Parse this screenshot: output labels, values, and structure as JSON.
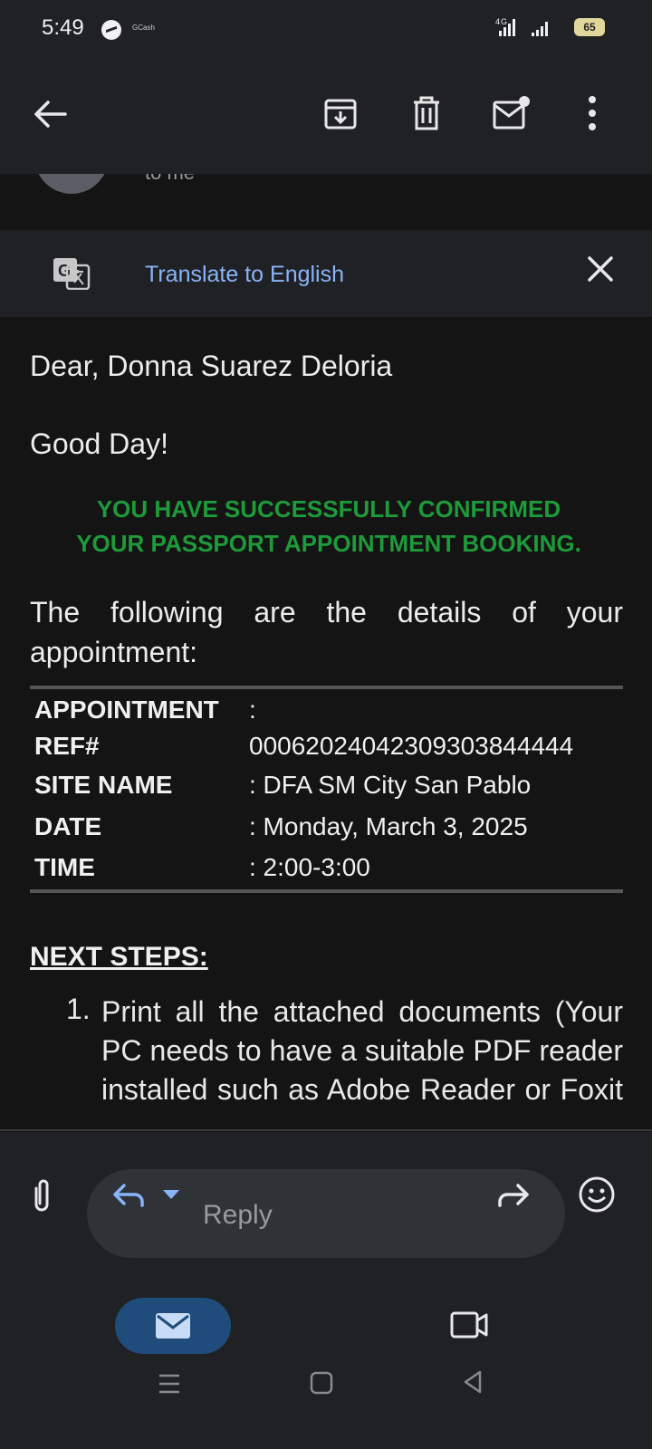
{
  "status_bar": {
    "time": "5:49",
    "app_label": "GCash",
    "network": "4G",
    "battery": "65"
  },
  "toolbar": {
    "icons": [
      "back-arrow-icon",
      "archive-icon",
      "delete-icon",
      "mark-unread-icon",
      "more-vert-icon"
    ]
  },
  "sender": {
    "to_line": "to me"
  },
  "translate": {
    "link": "Translate to English"
  },
  "email": {
    "greeting": "Dear, Donna Suarez Deloria",
    "good_day": "Good Day!",
    "confirm_line1": "YOU HAVE SUCCESSFULLY CONFIRMED",
    "confirm_line2": "YOUR PASSPORT APPOINTMENT BOOKING.",
    "intro": "The following are the details of your appointment:",
    "details": {
      "appointment_label": "APPOINTMENT",
      "ref_label": "REF#",
      "ref_value": "00062024042309303844444",
      "site_label": "SITE NAME",
      "site_value": ": DFA SM City San Pablo",
      "date_label": "DATE",
      "date_value": ": Monday, March 3, 2025",
      "time_label": "TIME",
      "time_value": ": 2:00-3:00"
    },
    "next_steps_heading": "NEXT STEPS:",
    "step_number": "1.",
    "step_text": "Print all the attached documents (Your PC needs to have a suitable PDF reader installed such as Adobe Reader or Foxit"
  },
  "reply_bar": {
    "reply_label": "Reply"
  },
  "colors": {
    "background": "#141414",
    "surface": "#1f2125",
    "link": "#8ab4f8",
    "success_green": "#1e9a3a",
    "mail_tab": "#1f4c7a"
  }
}
